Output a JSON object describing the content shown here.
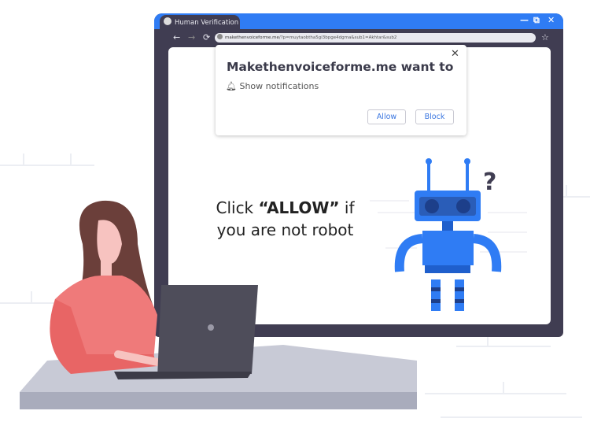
{
  "window": {
    "tab_title": "Human Verification",
    "controls": {
      "minimize": "—",
      "restore": "⧉",
      "close": "✕"
    },
    "nav": {
      "back": "←",
      "forward": "→",
      "reload": "⟳",
      "bookmark": "☆"
    },
    "address": {
      "domain": "makethenvoiceforme.me",
      "path": "/?p=muytaobtha5gi3bpge4dgma&sub1=Akhtar&sub2"
    }
  },
  "popup": {
    "title": "Makethenvoiceforme.me want to",
    "close": "✕",
    "permission": "Show notifications",
    "allow_label": "Allow",
    "block_label": "Block"
  },
  "message": {
    "pre": "Click ",
    "emph": "“ALLOW”",
    "post": " if",
    "line2": "you  are not robot"
  },
  "robot": {
    "question_mark": "?"
  },
  "colors": {
    "titlebar": "#2f7cf4",
    "frame": "#403d52",
    "robot": "#2f7cf4",
    "shirt": "#ef7a7a",
    "hair": "#6b3f3a"
  }
}
